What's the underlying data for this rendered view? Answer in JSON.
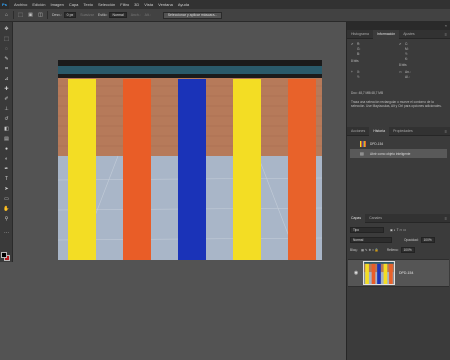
{
  "app": {
    "logo": "Ps"
  },
  "menu": [
    "Archivo",
    "Edición",
    "Imagen",
    "Capa",
    "Texto",
    "Selección",
    "Filtro",
    "3D",
    "Vista",
    "Ventana",
    "Ayuda"
  ],
  "options": {
    "fade_label": "Desv.:",
    "fade_value": "0 px",
    "antialias": "Suavizar",
    "style_label": "Estilo:",
    "style_value": "Normal",
    "width_label": "Anch.:",
    "height_label": "Alt.:",
    "select_mask_button": "Seleccionar y aplicar máscara..."
  },
  "document": {
    "stripe_colors": [
      "#f3dd24",
      "#e95d27",
      "#1a33b8",
      "#f3dd24",
      "#e8622a"
    ],
    "wall_color": "#b67a5a",
    "floor_color": "#a7b3c4",
    "rail_color": "#2a5a6a"
  },
  "panels": {
    "top_tabs": [
      "Histograma",
      "Información",
      "Ajustes"
    ],
    "active_top_tab": 1,
    "info": {
      "r_label": "R:",
      "g_label": "G:",
      "b_label": "B:",
      "c_label": "C:",
      "m_label": "M:",
      "y_label": "Y:",
      "k_label": "K:",
      "bits_left": "8 bits",
      "bits_right": "8 bits",
      "x_label": "X:",
      "y2_label": "Y:",
      "w_label": "An.:",
      "h_label": "Al.:",
      "doc_size": "Doc: 48,7 MB/48,7 MB",
      "hint": "Traza una selección rectangular o mueve el contorno de la selección. Use Mayúsculas, Alt y Ctrl para opciones adicionales."
    },
    "mid_tabs": [
      "Acciones",
      "Historia",
      "Propiedades"
    ],
    "active_mid_tab": 1,
    "history": [
      {
        "label": "DPD-154"
      },
      {
        "label": "Abrir como objeto inteligente"
      }
    ],
    "layers_tabs": [
      "Capas",
      "Canales"
    ],
    "active_layers_tab": 0,
    "layers": {
      "kind_label": "Tipo",
      "blend_mode": "Normal",
      "opacity_label": "Opacidad:",
      "opacity_value": "100%",
      "lock_label": "Bloq.:",
      "fill_label": "Relleno:",
      "fill_value": "100%",
      "items": [
        {
          "name": "DPD-154"
        }
      ]
    }
  },
  "colors": {
    "foreground": "#000000",
    "background": "#b3171c",
    "accent": "#31a8ff"
  }
}
